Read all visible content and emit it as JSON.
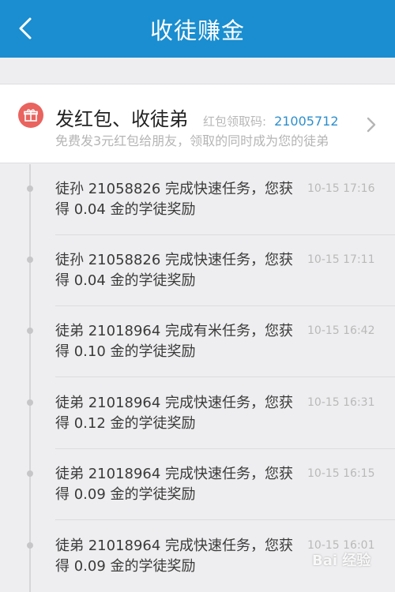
{
  "header": {
    "title": "收徒赚金",
    "back_icon": "chevron-left-icon"
  },
  "colors": {
    "header_bg": "#1a8ed0",
    "accent": "#2d8fcd",
    "gift_bg": "#e9635f"
  },
  "promo": {
    "icon": "gift-icon",
    "title": "发红包、收徒弟",
    "code_label": "红包领取码:",
    "code_value": "21005712",
    "subtitle": "免费发3元红包给朋友，领取的同时成为您的徒弟",
    "arrow_icon": "chevron-right-icon"
  },
  "records": [
    {
      "text": "徒孙 21058826 完成快速任务，您获得 0.04 金的学徒奖励",
      "time": "10-15 17:16"
    },
    {
      "text": "徒孙 21058826 完成快速任务，您获得 0.04 金的学徒奖励",
      "time": "10-15 17:11"
    },
    {
      "text": "徒弟 21018964 完成有米任务，您获得 0.10 金的学徒奖励",
      "time": "10-15 16:42"
    },
    {
      "text": "徒弟 21018964 完成快速任务，您获得 0.12 金的学徒奖励",
      "time": "10-15 16:31"
    },
    {
      "text": "徒弟 21018964 完成快速任务，您获得 0.09 金的学徒奖励",
      "time": "10-15 16:15"
    },
    {
      "text": "徒弟 21018964 完成快速任务，您获得 0.09 金的学徒奖励",
      "time": "10-15 16:01"
    }
  ],
  "watermark": "Bai 经验"
}
